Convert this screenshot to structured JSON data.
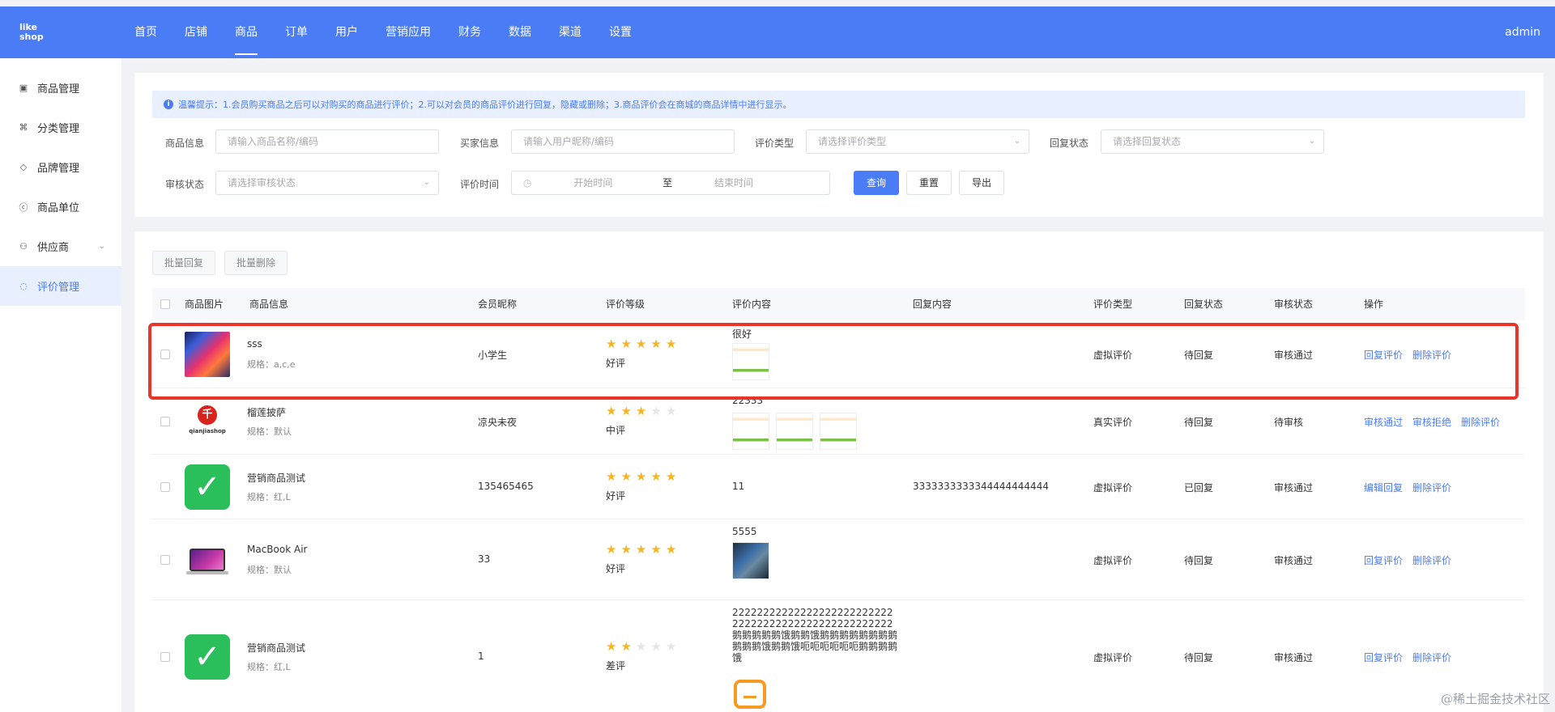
{
  "logo": {
    "line1": "like",
    "line2": "shop"
  },
  "nav": {
    "items": [
      "首页",
      "店铺",
      "商品",
      "订单",
      "用户",
      "营销应用",
      "财务",
      "数据",
      "渠道",
      "设置"
    ],
    "active_index": 2,
    "user": "admin"
  },
  "sidebar": {
    "items": [
      {
        "label": "商品管理",
        "icon": "box-icon"
      },
      {
        "label": "分类管理",
        "icon": "category-icon"
      },
      {
        "label": "品牌管理",
        "icon": "diamond-icon"
      },
      {
        "label": "商品单位",
        "icon": "unit-icon"
      },
      {
        "label": "供应商",
        "icon": "person-icon",
        "has_children": true
      },
      {
        "label": "评价管理",
        "icon": "comment-icon",
        "active": true
      }
    ]
  },
  "filters": {
    "tip": "温馨提示：1.会员购买商品之后可以对购买的商品进行评价；2.可以对会员的商品评价进行回复，隐藏或删除；3.商品评价会在商城的商品详情中进行显示。",
    "goods_label": "商品信息",
    "goods_placeholder": "请输入商品名称/编码",
    "buyer_label": "买家信息",
    "buyer_placeholder": "请输入用户昵称/编码",
    "type_label": "评价类型",
    "type_placeholder": "请选择评价类型",
    "reply_label": "回复状态",
    "reply_placeholder": "请选择回复状态",
    "audit_label": "审核状态",
    "audit_placeholder": "请选择审核状态",
    "time_label": "评价时间",
    "time_start": "开始时间",
    "time_sep": "至",
    "time_end": "结束时间",
    "query": "查询",
    "reset": "重置",
    "export": "导出"
  },
  "table": {
    "batch_reply": "批量回复",
    "batch_delete": "批量删除",
    "headers": [
      "商品图片",
      "商品信息",
      "会员昵称",
      "评价等级",
      "评价内容",
      "回复内容",
      "评价类型",
      "回复状态",
      "审核状态",
      "操作"
    ],
    "spec_prefix": "规格：",
    "rows": [
      {
        "name": "sss",
        "spec": "a,c,e",
        "member": "小学生",
        "rating": 5,
        "level": "好评",
        "content": "很好",
        "thumbs": 1,
        "reply": "",
        "type": "虚拟评价",
        "reply_status": "待回复",
        "audit": "审核通过",
        "ops": [
          "回复评价",
          "删除评价"
        ],
        "image": "colorful-abstract"
      },
      {
        "name": "榴莲披萨",
        "spec": "默认",
        "member": "凉央未夜",
        "rating": 3,
        "level": "中评",
        "content": "22333",
        "thumbs": 3,
        "reply": "",
        "type": "真实评价",
        "reply_status": "待回复",
        "audit": "待审核",
        "ops": [
          "审核通过",
          "审核拒绝",
          "删除评价"
        ],
        "image": "qianjiashop-logo",
        "image_text": "千",
        "image_caption": "qianjiashop"
      },
      {
        "name": "营销商品测试",
        "spec": "红,L",
        "member": "135465465",
        "rating": 5,
        "level": "好评",
        "content": "11",
        "thumbs": 0,
        "reply": "3333333333344444444444",
        "type": "虚拟评价",
        "reply_status": "已回复",
        "audit": "审核通过",
        "ops": [
          "编辑回复",
          "删除评价"
        ],
        "image": "green-check"
      },
      {
        "name": "MacBook Air",
        "spec": "默认",
        "member": "33",
        "rating": 5,
        "level": "好评",
        "content": "5555",
        "thumbs": 1,
        "reply": "",
        "type": "虚拟评价",
        "reply_status": "待回复",
        "audit": "审核通过",
        "ops": [
          "回复评价",
          "删除评价"
        ],
        "image": "laptop"
      },
      {
        "name": "营销商品测试",
        "spec": "红,L",
        "member": "1",
        "rating": 2,
        "level": "差评",
        "content": "2222222222222222222222222222222222222222222222222222鹅鹅鹅鹅鹅饿鹅鹅饿鹅鹅鹅鹅鹅鹅鹅鹅鹅鹅鹅饿鹅鹅饿呃呃呃呃呃呃鹅鹅鹅鹅饿",
        "thumbs": 0,
        "reply": "",
        "type": "虚拟评价",
        "reply_status": "待回复",
        "audit": "审核通过",
        "ops": [
          "回复评价",
          "删除评价"
        ],
        "image": "green-check",
        "has_shop_icon": true
      }
    ]
  },
  "watermark": "@稀土掘金技术社区",
  "colors": {
    "primary": "#4a7cf6",
    "star": "#f5b623",
    "highlight": "#e8342a"
  }
}
